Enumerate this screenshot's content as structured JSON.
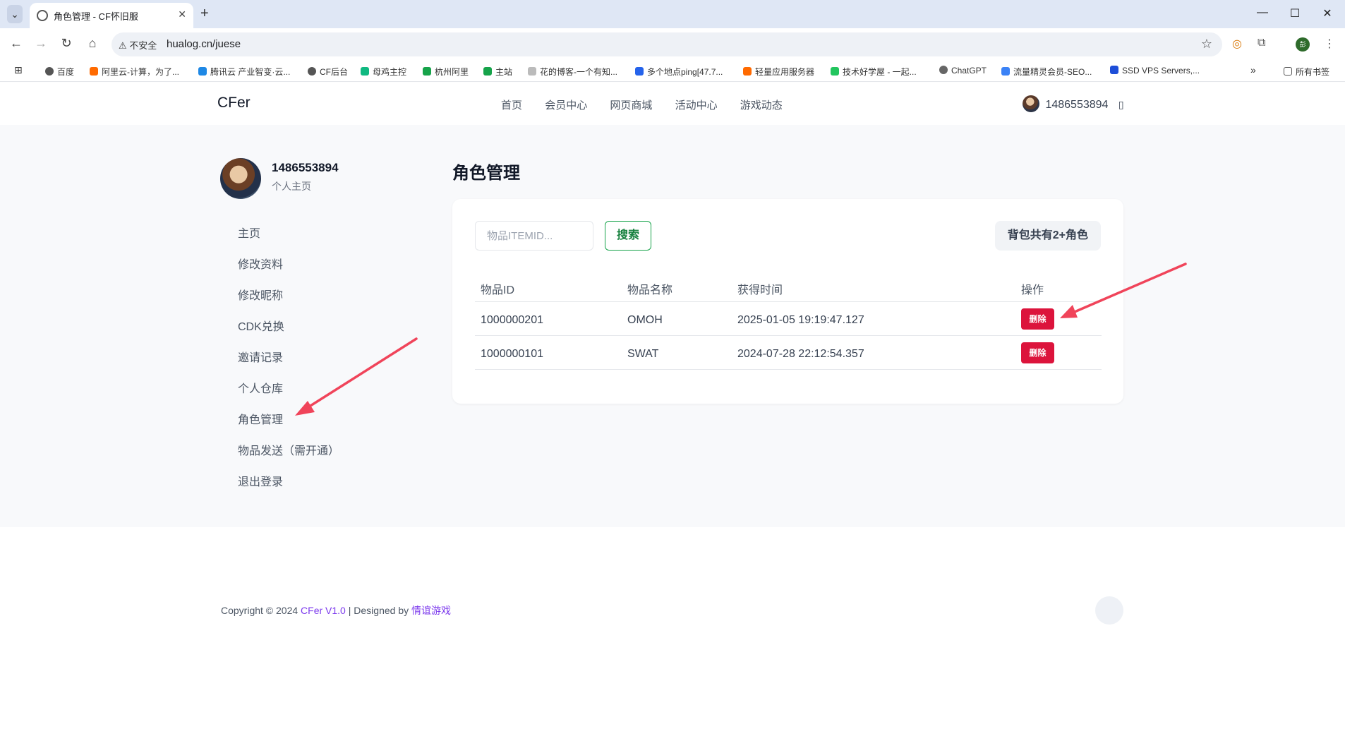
{
  "browser": {
    "tab_title": "角色管理 - CF怀旧服",
    "insecure_label": "不安全",
    "url": "hualog.cn/juese",
    "bookmarks": [
      "百度",
      "阿里云-计算，为了...",
      "腾讯云 产业智变·云...",
      "CF后台",
      "母鸡主控",
      "杭州阿里",
      "主站",
      "花的博客-一个有知...",
      "多个地点ping[47.7...",
      "轻量应用服务器",
      "技术好学屋 - 一起...",
      "ChatGPT",
      "流量精灵会员-SEO...",
      "SSD VPS Servers,..."
    ],
    "all_bookmarks": "所有书签",
    "profile_initial": "彭"
  },
  "site": {
    "logo": "CFer",
    "nav": [
      "首页",
      "会员中心",
      "网页商城",
      "活动中心",
      "游戏动态"
    ],
    "header_user": "1486553894"
  },
  "sidebar": {
    "username": "1486553894",
    "subtitle": "个人主页",
    "items": [
      "主页",
      "修改资料",
      "修改昵称",
      "CDK兑换",
      "邀请记录",
      "个人仓库",
      "角色管理",
      "物品发送（需开通）",
      "退出登录"
    ]
  },
  "main": {
    "title": "角色管理",
    "search_placeholder": "物品ITEMID...",
    "search_button": "搜索",
    "badge": "背包共有2+角色",
    "columns": [
      "物品ID",
      "物品名称",
      "获得时间",
      "操作"
    ],
    "rows": [
      {
        "id": "1000000201",
        "name": "OMOH",
        "time": "2025-01-05 19:19:47.127",
        "action": "删除"
      },
      {
        "id": "1000000101",
        "name": "SWAT",
        "time": "2024-07-28 22:12:54.357",
        "action": "删除"
      }
    ]
  },
  "footer": {
    "prefix": "Copyright © 2024 ",
    "brand": "CFer V1.0",
    "middle": " | Designed by ",
    "designer": "情谊游戏"
  },
  "colors": {
    "accent_purple": "#7c3aed",
    "delete_red": "#dc143c",
    "search_green": "#15803d",
    "annotation_arrow": "#f0445a"
  }
}
